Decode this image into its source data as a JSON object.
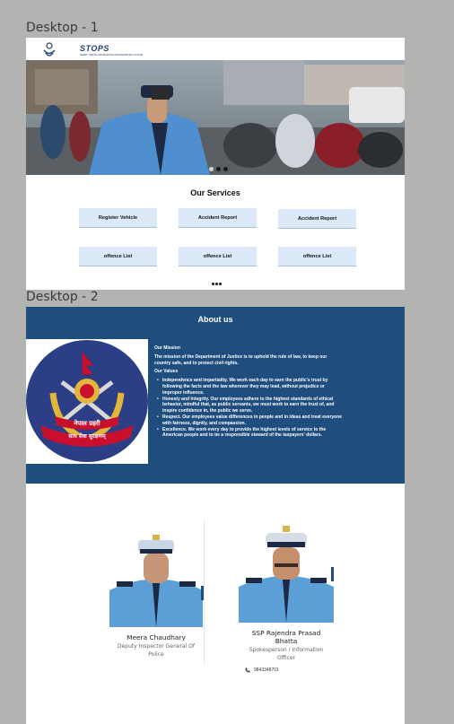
{
  "frames": {
    "first_label": "Desktop - 1",
    "second_label": "Desktop - 2"
  },
  "header": {
    "logo_title": "STOPS",
    "logo_subtitle": "SMART TRAFFIC INFORMATION AND REPORTING SYSTEM"
  },
  "services": {
    "title": "Our Services",
    "items": [
      "Register  Vehicle",
      "Accident Report",
      "Accident Report",
      "offence List",
      "offence List",
      "offence List"
    ]
  },
  "about": {
    "title": "About us",
    "emblem_text_top": "नेपाल प्रहरी",
    "emblem_text_bottom": "सत्य सेवा सुरक्षणम्",
    "mission_heading": "Our Mission",
    "mission_text": "The mission of the Department of Justice is to uphold the rule of law, to keep our country safe, and to protect civil rights.",
    "values_heading": "Our Values",
    "values": [
      "Independence and impartiality. We work each day to earn the public's trust by following the facts and the law wherever they may lead, without prejudice or improper influence.",
      "Honesty and Integrity. Our employees adhere to the highest standards of ethical behavior, mindful that, as public servants, we must work to earn the trust of, and inspire confidence in, the public we serve.",
      "Respect. Our employees value differences in people and in ideas and treat everyone with fairness, dignity, and compassion.",
      "Excellence. We work every day to provide the highest levels of service to the American people and to be a responsible steward of the taxpayers' dollars."
    ]
  },
  "officers": [
    {
      "name": "Meera Chaudhary",
      "role": "Deputy Inspector General Of Police"
    },
    {
      "name": "SSP Rajendra Prasad Bhatta",
      "role": "Spokesperson / Information Officer",
      "phone": "9843348701"
    }
  ],
  "colors": {
    "brand_blue": "#1e4d7e",
    "service_button": "#dce9f8",
    "uniform_blue": "#5b9fd6"
  }
}
